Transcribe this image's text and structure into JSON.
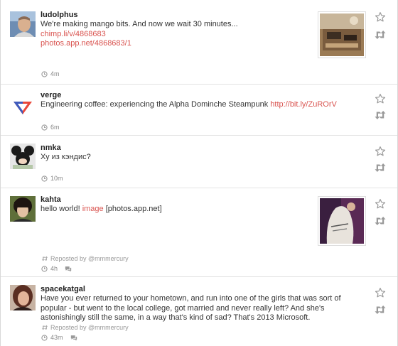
{
  "posts": [
    {
      "username": "ludolphus",
      "text": "We're making mango bits. And now we wait 30 minutes...",
      "links": [
        "chimp.li/v/4868683",
        "photos.app.net/4868683/1"
      ],
      "time": "4m",
      "has_thumb": true,
      "thumb_colors": [
        "#8a6b45",
        "#c9b08a",
        "#4a3a2a"
      ]
    },
    {
      "username": "verge",
      "text": "Engineering coffee: experiencing the Alpha Dominche Steampunk ",
      "link": "http://bit.ly/ZuROrV",
      "time": "6m"
    },
    {
      "username": "nmka",
      "text": "Ху из кэндис?",
      "time": "10m"
    },
    {
      "username": "kahta",
      "text_prefix": "hello world! ",
      "link": "image",
      "text_suffix": " [photos.app.net]",
      "reposted_by": "Reposted by @mmmercury",
      "time": "4h",
      "has_thumb": true
    },
    {
      "username": "spacekatgal",
      "text": "Have you ever returned to your hometown, and run into one of the girls that was sort of popular - but went to the local college, got married and never really left? And she's astonishingly still the same, in a way that's kind of sad? That's 2013 Microsoft.",
      "reposted_by": "Reposted by @mmmercury",
      "time": "43m"
    }
  ],
  "colors": {
    "link": "#d9534f",
    "meta": "#888888",
    "icon": "#9a9a9a",
    "divider": "#e3e3e3"
  },
  "icons": {
    "favorite": "star-icon",
    "repost": "repost-icon",
    "time": "clock-icon",
    "reply": "conversation-icon"
  }
}
